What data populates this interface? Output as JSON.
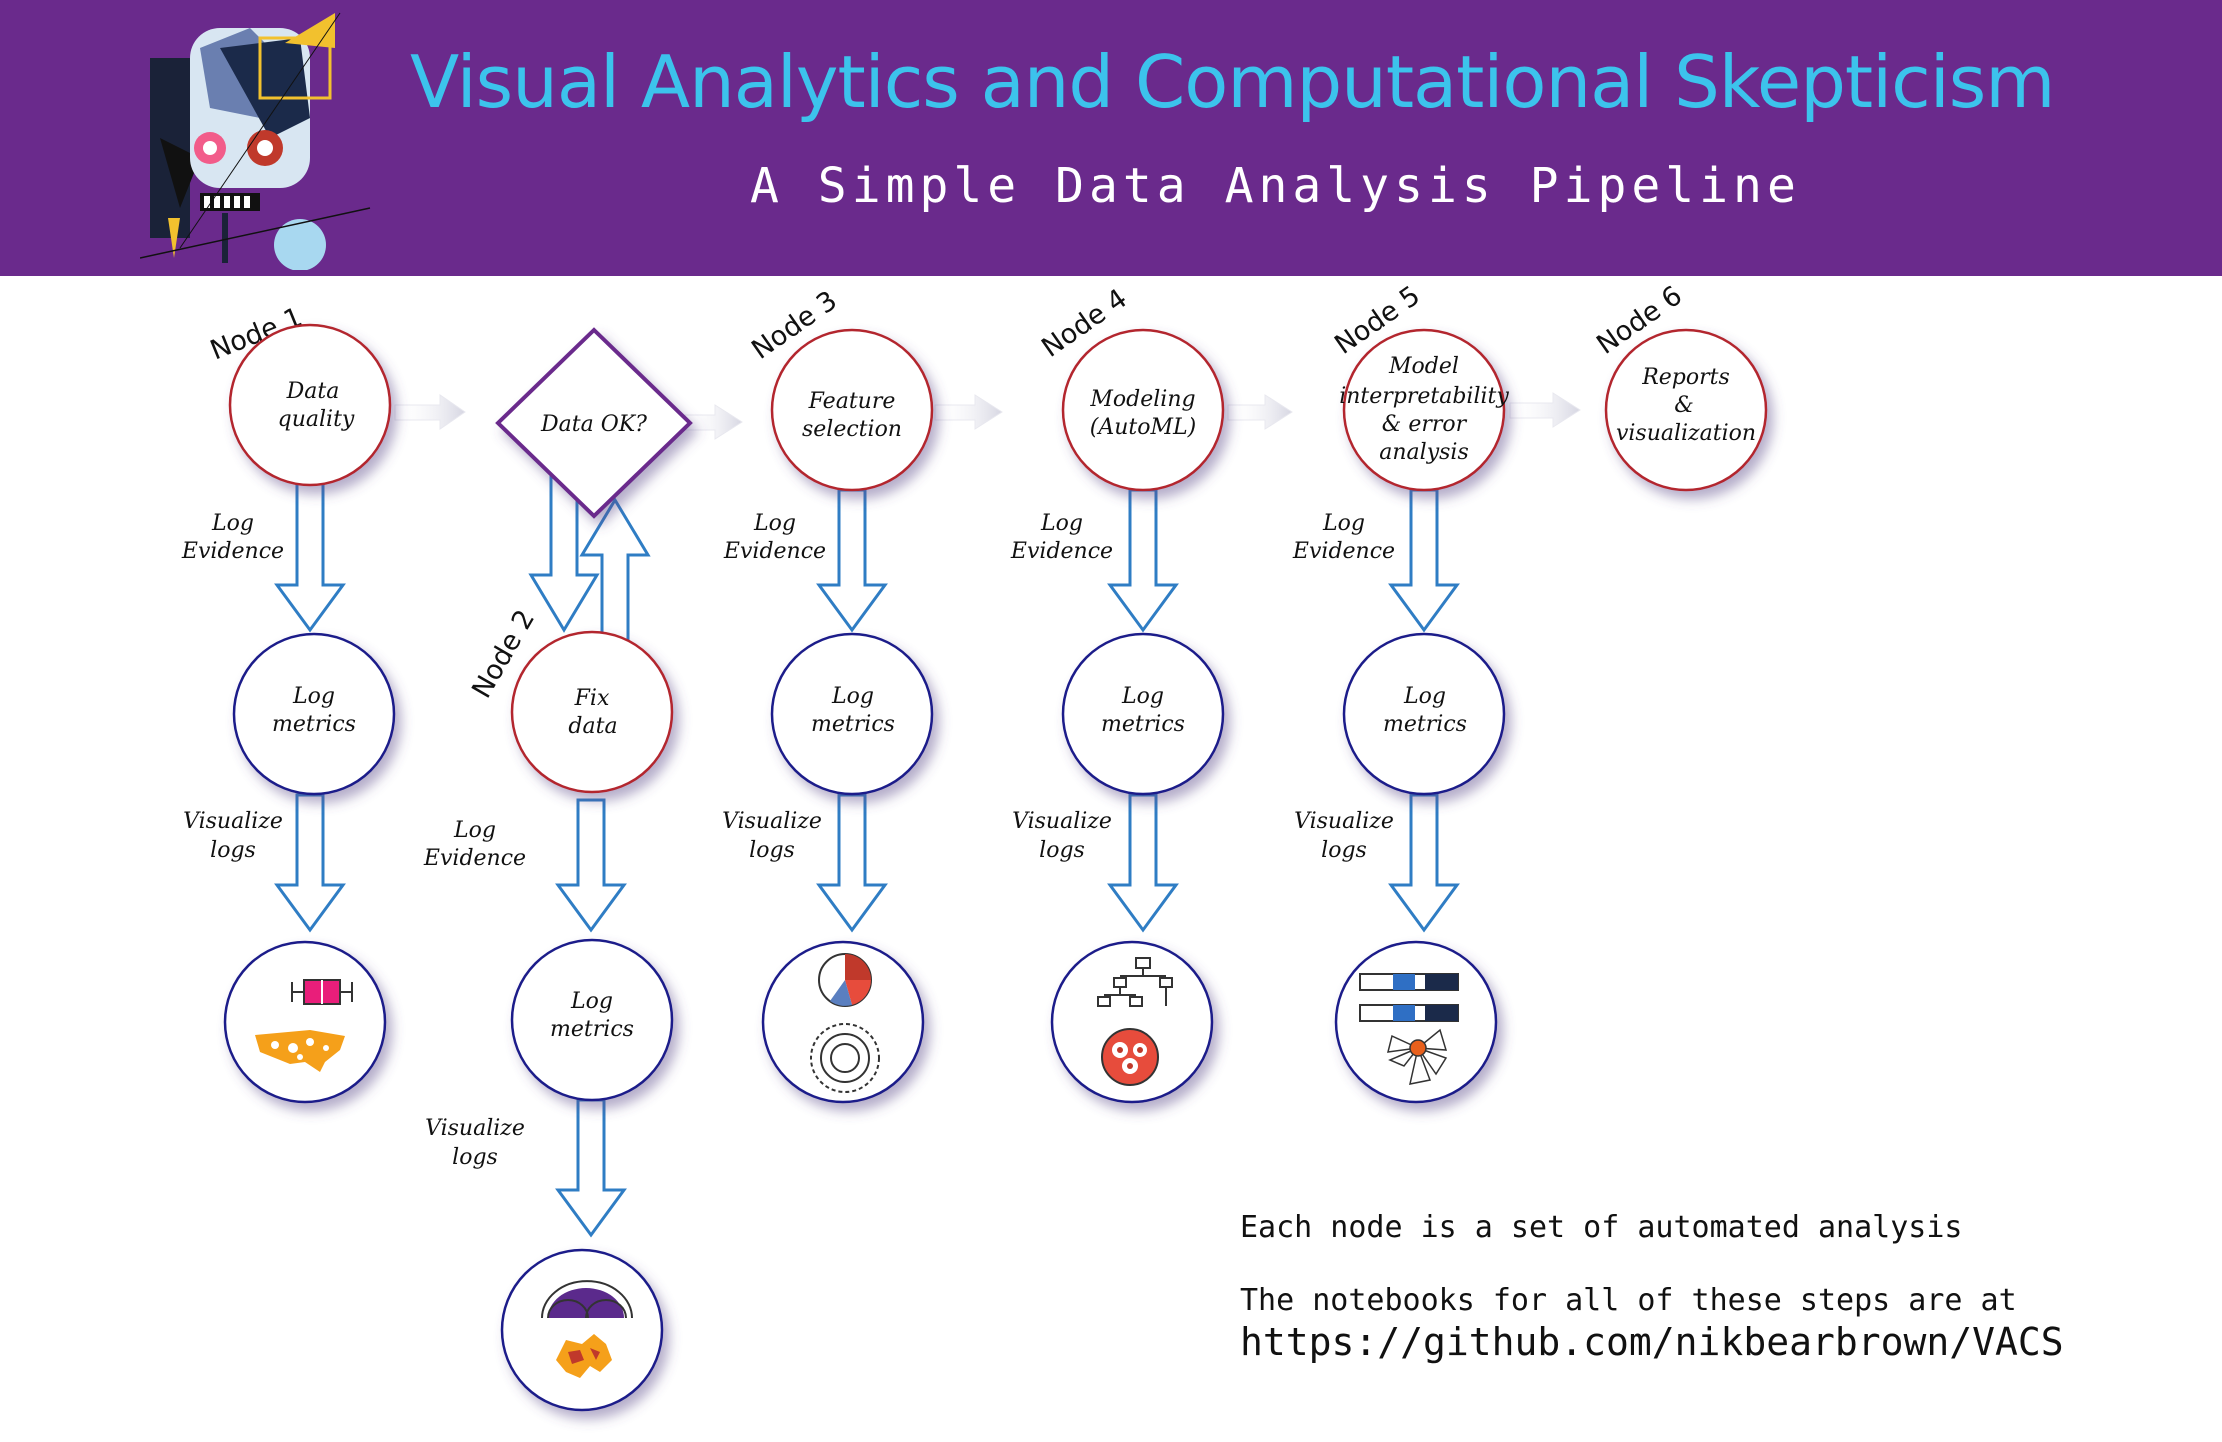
{
  "header": {
    "title": "Visual Analytics and Computational Skepticism",
    "subtitle": "A Simple Data Analysis Pipeline"
  },
  "nodes": {
    "n1": {
      "label": "Node 1",
      "line1": "Data",
      "line2": "quality"
    },
    "n2": {
      "label": "Node 2",
      "line1": "Fix",
      "line2": "data"
    },
    "n3": {
      "label": "Node 3",
      "line1": "Feature",
      "line2": "selection"
    },
    "n4": {
      "label": "Node 4",
      "line1": "Modeling",
      "line2": "(AutoML)"
    },
    "n5": {
      "label": "Node 5",
      "line1": "Model",
      "line2": "interpretability",
      "line3": "& error",
      "line4": "analysis"
    },
    "n6": {
      "label": "Node 6",
      "line1": "Reports",
      "line2": "&",
      "line3": "visualization"
    }
  },
  "decision": {
    "label": "Data OK?"
  },
  "common": {
    "log_evidence_1": "Log",
    "log_evidence_2": "Evidence",
    "log_metrics_1": "Log",
    "log_metrics_2": "metrics",
    "visualize_1": "Visualize",
    "visualize_2": "logs"
  },
  "notes": {
    "line1": "Each node is a set of automated analysis",
    "line2": "The notebooks for all of these steps are at",
    "link": "https://github.com/nikbearbrown/VACS"
  },
  "colors": {
    "header_bg": "#6a2a8c",
    "title": "#3cc3ec",
    "node_border": "#b3262e",
    "log_border": "#1b1f8a",
    "arrow": "#2f7dc4",
    "diamond": "#6a2a8c"
  }
}
